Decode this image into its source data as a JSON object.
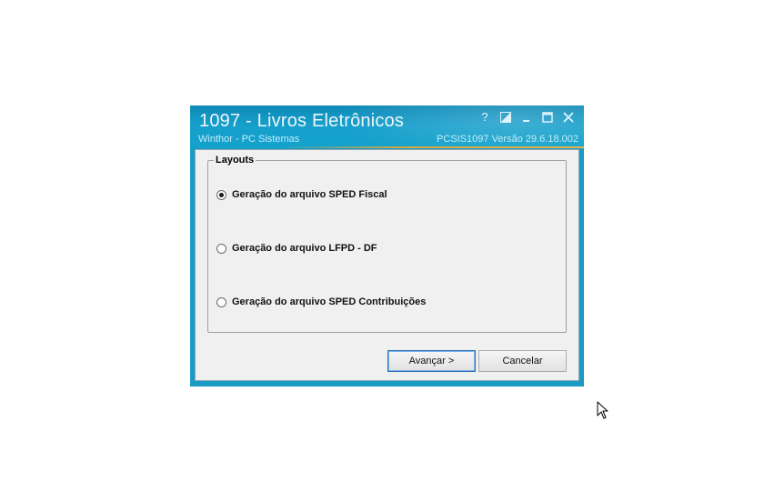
{
  "window": {
    "title": "1097 - Livros Eletrônicos",
    "company": "Winthor - PC Sistemas",
    "version_info": "PCSIS1097  Versão  29.6.18.002",
    "controls": {
      "help_icon": "question-mark-icon",
      "resize_icon": "resize-icon",
      "minimize_icon": "minimize-icon",
      "maximize_icon": "maximize-icon",
      "close_icon": "close-icon"
    }
  },
  "layouts": {
    "group_label": "Layouts",
    "options": [
      {
        "label": "Geração do arquivo SPED Fiscal",
        "checked": true
      },
      {
        "label": "Geração do arquivo LFPD - DF",
        "checked": false
      },
      {
        "label": "Geração do arquivo SPED Contribuições",
        "checked": false
      }
    ]
  },
  "buttons": {
    "next_label": "Avançar >",
    "cancel_label": "Cancelar"
  },
  "colors": {
    "title_bar": "#169fcb",
    "window_border": "#1b9bc4",
    "accent_line": "#d9a73c",
    "client_bg": "#f0f0f0",
    "default_button_border": "#2b6fb6"
  }
}
